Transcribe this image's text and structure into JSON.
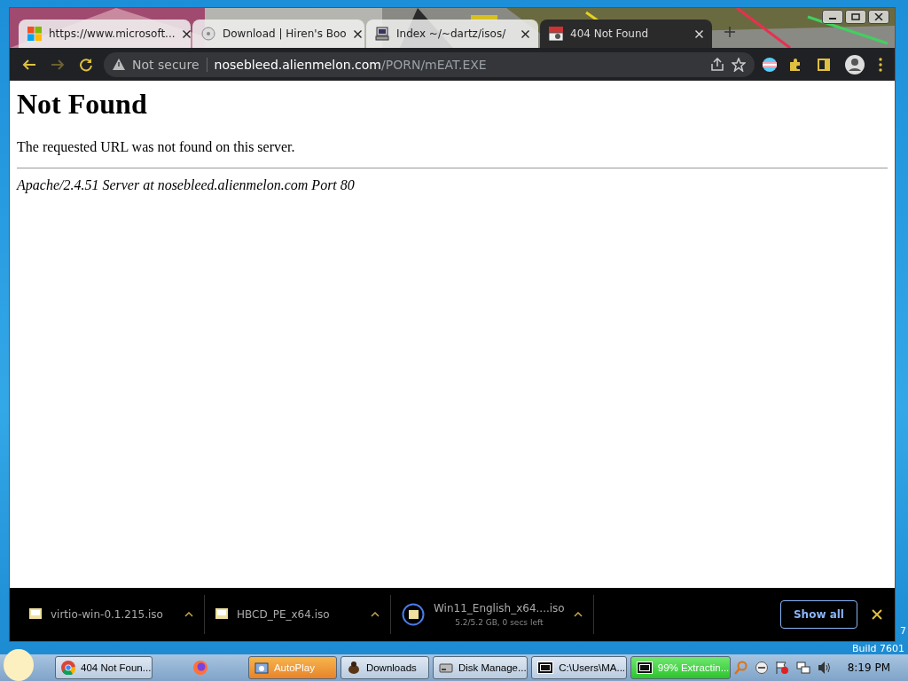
{
  "browser": {
    "tabs": [
      {
        "title": "https://www.microsoft...",
        "selected": false
      },
      {
        "title": "Download | Hiren's Boo",
        "selected": false
      },
      {
        "title": "Index ~/~dartz/isos/",
        "selected": false
      },
      {
        "title": "404 Not Found",
        "selected": true
      }
    ],
    "address": {
      "security": "Not secure",
      "host": "nosebleed.alienmelon.com",
      "path": "/PORN/mEAT.EXE"
    },
    "page": {
      "heading": "Not Found",
      "message": "The requested URL was not found on this server.",
      "footer": "Apache/2.4.51 Server at nosebleed.alienmelon.com Port 80"
    },
    "downloads": [
      {
        "name": "virtio-win-0.1.215.iso"
      },
      {
        "name": "HBCD_PE_x64.iso"
      },
      {
        "name": "Win11_English_x64....iso",
        "status": "5.2/5.2 GB, 0 secs left",
        "kind": "progress"
      }
    ],
    "show_all": "Show all"
  },
  "desktop": {
    "build": "Build 7601",
    "corner": "7"
  },
  "taskbar": {
    "items": [
      {
        "label": "404 Not Foun...",
        "kind": "normal"
      },
      {
        "kind": "icon"
      },
      {
        "label": "AutoPlay",
        "kind": "active"
      },
      {
        "label": "Downloads",
        "kind": "normal"
      },
      {
        "label": "Disk Manage...",
        "kind": "normal"
      },
      {
        "label": "C:\\Users\\MA...",
        "kind": "normal"
      },
      {
        "label": "99% Extractin...",
        "kind": "progress"
      }
    ],
    "clock": "8:19 PM"
  }
}
